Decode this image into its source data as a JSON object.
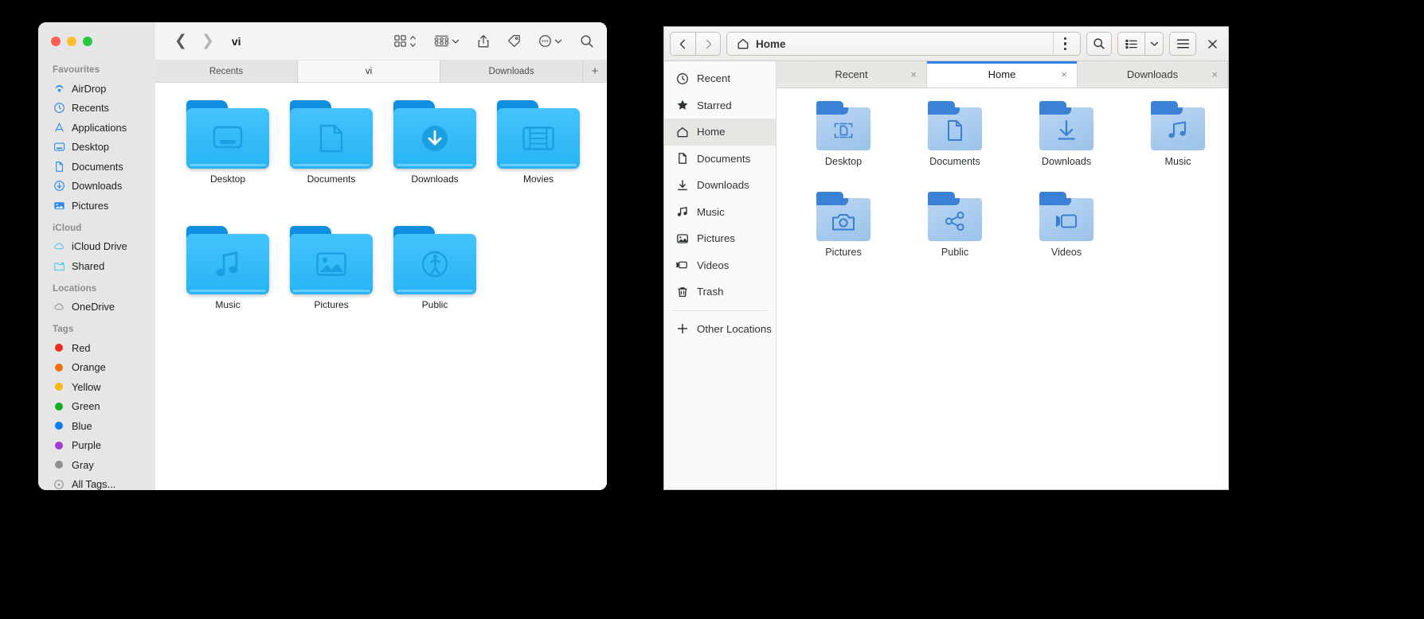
{
  "mac_window": {
    "title": "vi",
    "traffic_lights": [
      {
        "name": "close",
        "color": "#ff5f57"
      },
      {
        "name": "minimize",
        "color": "#febc2e"
      },
      {
        "name": "zoom",
        "color": "#28c840"
      }
    ],
    "toolbar": {
      "back_icon": "chevron-left",
      "forward_icon": "chevron-right",
      "view_grid_icon": "grid-view-icon",
      "view_list_icon": "list-view-icon",
      "share_icon": "share-icon",
      "tag_icon": "tag-icon",
      "more_icon": "more-ellipsis-icon",
      "search_icon": "search-icon"
    },
    "tabs": [
      {
        "label": "Recents",
        "active": false
      },
      {
        "label": "vi",
        "active": true
      },
      {
        "label": "Downloads",
        "active": false
      }
    ],
    "tab_add_label": "+",
    "sidebar": [
      {
        "title": "Favourites",
        "items": [
          {
            "label": "AirDrop",
            "icon": "airdrop-icon"
          },
          {
            "label": "Recents",
            "icon": "clock-icon"
          },
          {
            "label": "Applications",
            "icon": "applications-icon"
          },
          {
            "label": "Desktop",
            "icon": "desktop-icon"
          },
          {
            "label": "Documents",
            "icon": "document-icon"
          },
          {
            "label": "Downloads",
            "icon": "download-icon"
          },
          {
            "label": "Pictures",
            "icon": "pictures-icon"
          }
        ]
      },
      {
        "title": "iCloud",
        "items": [
          {
            "label": "iCloud Drive",
            "icon": "cloud-icon"
          },
          {
            "label": "Shared",
            "icon": "shared-folder-icon"
          }
        ]
      },
      {
        "title": "Locations",
        "items": [
          {
            "label": "OneDrive",
            "icon": "cloud-gray-icon"
          }
        ]
      },
      {
        "title": "Tags",
        "items": [
          {
            "label": "Red",
            "icon": "tag-dot-icon",
            "color": "#ee2a21"
          },
          {
            "label": "Orange",
            "icon": "tag-dot-icon",
            "color": "#f5700f"
          },
          {
            "label": "Yellow",
            "icon": "tag-dot-icon",
            "color": "#fdb60d"
          },
          {
            "label": "Green",
            "icon": "tag-dot-icon",
            "color": "#12ac28"
          },
          {
            "label": "Blue",
            "icon": "tag-dot-icon",
            "color": "#0a7ef2"
          },
          {
            "label": "Purple",
            "icon": "tag-dot-icon",
            "color": "#a33bd4"
          },
          {
            "label": "Gray",
            "icon": "tag-dot-icon",
            "color": "#8e8e93"
          },
          {
            "label": "All Tags...",
            "icon": "all-tags-icon",
            "color": "#8e8e93"
          }
        ]
      }
    ],
    "files": [
      {
        "label": "Desktop",
        "icon": "folder-desktop-icon"
      },
      {
        "label": "Documents",
        "icon": "folder-documents-icon"
      },
      {
        "label": "Downloads",
        "icon": "folder-downloads-icon"
      },
      {
        "label": "Movies",
        "icon": "folder-movies-icon"
      },
      {
        "label": "Music",
        "icon": "folder-music-icon"
      },
      {
        "label": "Pictures",
        "icon": "folder-pictures-icon"
      },
      {
        "label": "Public",
        "icon": "folder-public-icon"
      }
    ]
  },
  "gtk_window": {
    "path_label": "Home",
    "header": {
      "back_icon": "chevron-left",
      "forward_icon": "chevron-right",
      "home_icon": "home-icon",
      "path_menu_icon": "vertical-dots-icon",
      "search_icon": "search-icon",
      "view_toggle_icon": "list-view-icon",
      "view_dropdown_icon": "chevron-down-icon",
      "hamburger_icon": "hamburger-menu-icon",
      "close_icon": "close-icon"
    },
    "tabs": [
      {
        "label": "Recent",
        "active": false,
        "close": "×"
      },
      {
        "label": "Home",
        "active": true,
        "close": "×"
      },
      {
        "label": "Downloads",
        "active": false,
        "close": "×"
      }
    ],
    "sidebar": [
      {
        "label": "Recent",
        "icon": "clock-icon",
        "selected": false
      },
      {
        "label": "Starred",
        "icon": "star-icon",
        "selected": false
      },
      {
        "label": "Home",
        "icon": "home-icon",
        "selected": true
      },
      {
        "label": "Documents",
        "icon": "document-icon",
        "selected": false
      },
      {
        "label": "Downloads",
        "icon": "download-icon",
        "selected": false
      },
      {
        "label": "Music",
        "icon": "music-icon",
        "selected": false
      },
      {
        "label": "Pictures",
        "icon": "pictures-icon",
        "selected": false
      },
      {
        "label": "Videos",
        "icon": "video-icon",
        "selected": false
      },
      {
        "label": "Trash",
        "icon": "trash-icon",
        "selected": false
      }
    ],
    "other_locations": {
      "label": "Other Locations",
      "icon": "plus-icon"
    },
    "files": [
      {
        "label": "Desktop",
        "icon": "folder-desktop-icon"
      },
      {
        "label": "Documents",
        "icon": "folder-documents-icon"
      },
      {
        "label": "Downloads",
        "icon": "folder-downloads-icon"
      },
      {
        "label": "Music",
        "icon": "folder-music-icon"
      },
      {
        "label": "Pictures",
        "icon": "folder-pictures-icon"
      },
      {
        "label": "Public",
        "icon": "folder-public-icon"
      },
      {
        "label": "Videos",
        "icon": "folder-videos-icon"
      }
    ]
  }
}
